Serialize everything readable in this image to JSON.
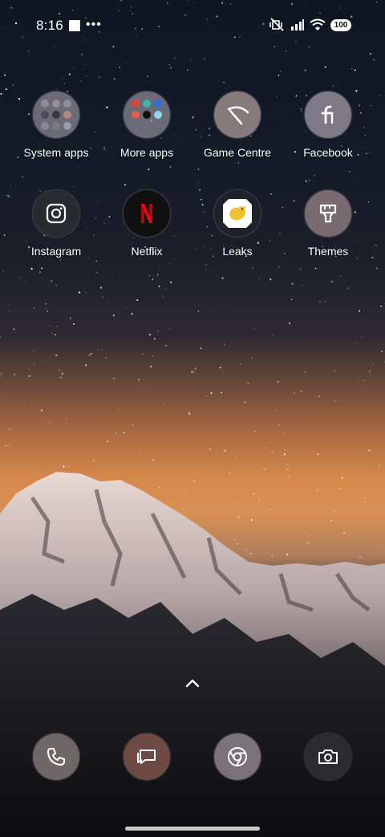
{
  "status_bar": {
    "time": "8:16",
    "battery": "100"
  },
  "apps": [
    {
      "label": "System apps",
      "icon": "system-apps-folder-icon"
    },
    {
      "label": "More apps",
      "icon": "more-apps-folder-icon"
    },
    {
      "label": "Game Centre",
      "icon": "game-centre-icon"
    },
    {
      "label": "Facebook",
      "icon": "facebook-icon"
    },
    {
      "label": "Instagram",
      "icon": "instagram-icon"
    },
    {
      "label": "Netflix",
      "icon": "netflix-icon"
    },
    {
      "label": "Leaks",
      "icon": "leaks-icon"
    },
    {
      "label": "Themes",
      "icon": "themes-icon"
    }
  ],
  "dock": [
    {
      "icon": "phone-icon"
    },
    {
      "icon": "messages-icon"
    },
    {
      "icon": "chrome-icon"
    },
    {
      "icon": "camera-icon"
    }
  ],
  "colors": {
    "icon_bg": "#857c7f",
    "netflix_red": "#e50914",
    "leaks_yellow": "#f2c12e"
  }
}
